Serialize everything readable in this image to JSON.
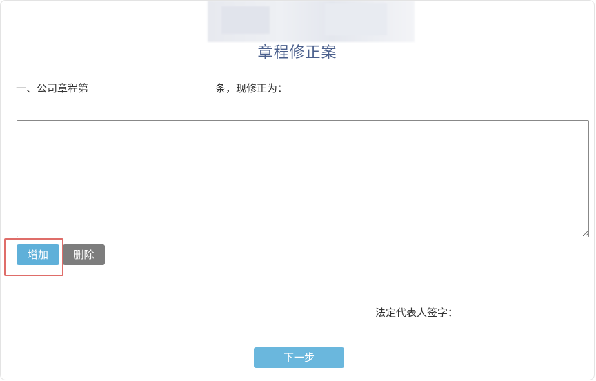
{
  "form": {
    "title": "章程修正案",
    "clause": {
      "prefix": "一、公司章程第",
      "input_value": "",
      "suffix": "条，现修正为："
    },
    "amendment_text": "",
    "buttons": {
      "add_label": "增加",
      "delete_label": "删除",
      "next_label": "下一步"
    },
    "signature_label": "法定代表人签字："
  },
  "colors": {
    "title": "#4a5f8c",
    "add_button": "#5fb0d9",
    "delete_button": "#7d7d7d",
    "next_button": "#6ab7dd",
    "highlight": "#d9534f"
  }
}
